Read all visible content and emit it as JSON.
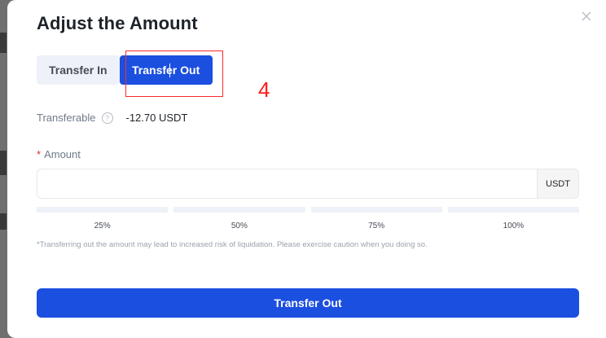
{
  "dialog": {
    "title": "Adjust the Amount",
    "close_icon": "close-icon"
  },
  "tabs": [
    {
      "label": "Transfer In",
      "active": false
    },
    {
      "label": "Transfer Out",
      "active": true
    }
  ],
  "annotation": {
    "number": "4",
    "color": "#ff1a1a"
  },
  "transferable": {
    "label": "Transferable",
    "help_icon": "question-circle-icon",
    "value": "-12.70 USDT"
  },
  "amount": {
    "required_mark": "*",
    "label": "Amount",
    "value": "",
    "placeholder": "",
    "unit": "USDT"
  },
  "percent_options": [
    "25%",
    "50%",
    "75%",
    "100%"
  ],
  "note": "*Transferring out the amount may lead to increased risk of liquidation. Please exercise caution when you doing so.",
  "submit_label": "Transfer Out",
  "colors": {
    "primary": "#1b4fe0",
    "tab_inactive_bg": "#eef1f8",
    "required": "#e0282e"
  }
}
